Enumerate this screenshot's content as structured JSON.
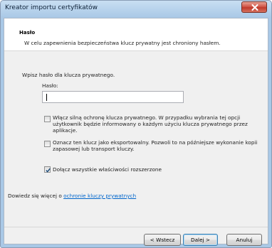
{
  "window": {
    "title": "Kreator importu certyfikatów"
  },
  "header": {
    "section_title": "Hasło",
    "description": "W celu zapewnienia bezpieczeństwa klucz prywatny jest chroniony hasłem."
  },
  "form": {
    "prompt": "Wpisz hasło dla klucza prywatnego.",
    "password_label": "Hasło:",
    "password_value": ""
  },
  "options": [
    {
      "lines": [
        "Włącz silną ochronę klucza prywatnego. W przypadku wybrania tej opcji",
        "użytkownik będzie informowany o każdym użyciu klucza prywatnego przez",
        "aplikacje."
      ],
      "checked": false
    },
    {
      "lines": [
        "Oznacz ten klucz jako eksportowalny. Pozwoli to na późniejsze wykonanie kopii",
        "zapasowej lub transport kluczy."
      ],
      "checked": false
    },
    {
      "lines": [
        "Dołącz wszystkie właściwości rozszerzone"
      ],
      "checked": true
    }
  ],
  "learn_more": {
    "prefix": "Dowiedz się więcej o ",
    "link_text": "ochronie kluczy prywatnych"
  },
  "buttons": {
    "back": "< Wstecz",
    "next": "Dalej >",
    "cancel": "Anuluj"
  },
  "colors": {
    "titlebar": "#b8d3ec",
    "close_button": "#c0392b",
    "link": "#0066cc",
    "default_button_border": "#3c7fb1"
  },
  "icons": {
    "close": "close-icon",
    "checkmark": "checkmark-icon"
  }
}
